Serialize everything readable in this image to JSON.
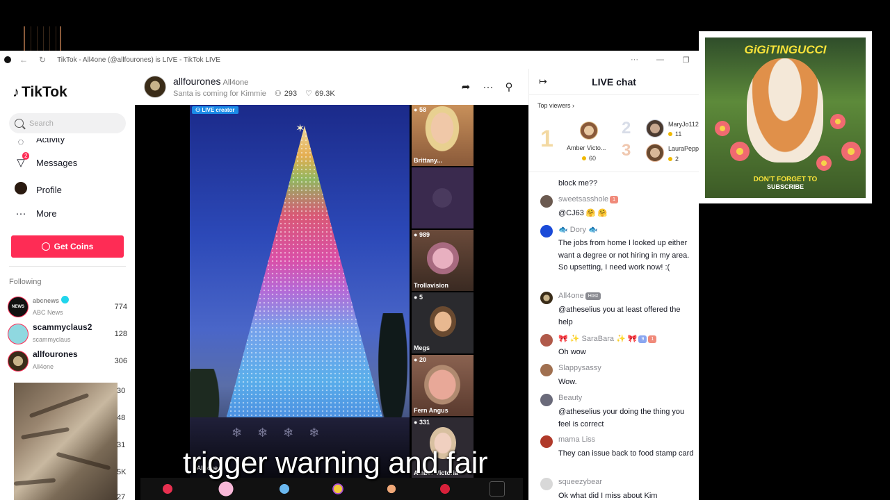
{
  "browser": {
    "title": "TikTok - All4one (@allfourones) is LIVE - TikTok LIVE",
    "controls": [
      "···",
      "—",
      "❐"
    ]
  },
  "sidebar": {
    "brand": "TikTok",
    "search_placeholder": "Search",
    "activity_label": "Activity",
    "nav": [
      {
        "label": "Messages",
        "icon": "paper-plane-icon",
        "badge": "2"
      },
      {
        "label": "Profile",
        "icon": "avatar"
      },
      {
        "label": "More",
        "icon": "more-dots-icon"
      }
    ],
    "get_coins": "Get Coins",
    "following_heading": "Following",
    "following": [
      {
        "name": "abcnews",
        "handle": "ABC News",
        "count": "774",
        "verified": true,
        "color": "#111111"
      },
      {
        "name": "scammyclaus2",
        "handle": "scammyclaus",
        "count": "128",
        "verified": false,
        "color": "#8fd8e0"
      },
      {
        "name": "allfourones",
        "handle": "All4one",
        "count": "306",
        "verified": false,
        "color": "#3a2c18"
      }
    ],
    "partial_counts": [
      "30",
      "48",
      "31",
      "5K",
      "27"
    ]
  },
  "stream": {
    "host_name": "allfourones",
    "host_nick": "All4one",
    "subtitle": "Santa is coming for Kimmie",
    "viewers": "293",
    "likes": "69.3K",
    "live_tag": "LIVE creator",
    "host_overlay": "All4one",
    "guests": [
      {
        "count": "58",
        "name": "Brittany...",
        "bg": "#a8704a"
      },
      {
        "count": "",
        "name": "",
        "bg": "#3a2a4e"
      },
      {
        "count": "989",
        "name": "Trollavision",
        "bg": "#5a3a2a"
      },
      {
        "count": "5",
        "name": "Megs",
        "bg": "#2a2a2e"
      },
      {
        "count": "20",
        "name": "Fern Angus",
        "bg": "#7a5240"
      },
      {
        "count": "331",
        "name": "Amber Victoria",
        "bg": "#2e2a32"
      }
    ]
  },
  "overlay_caption": "trigger warning and fair",
  "chat": {
    "title": "LIVE chat",
    "top_viewers_label": "Top viewers",
    "top_viewers": [
      {
        "rank": "1",
        "name": "Amber Victo...",
        "points": "60"
      },
      {
        "rank": "2",
        "name": "MaryJo112",
        "points": "11"
      },
      {
        "rank": "3",
        "name": "LauraPepp",
        "points": "2"
      }
    ],
    "messages": [
      {
        "user": "",
        "text": "block me??",
        "color": "#ffffff"
      },
      {
        "user": "sweetsasshole",
        "badge": "1",
        "badge_color": "#f08a7a",
        "text": "@CJ63 🤗 🤗",
        "color": "#6b5a50"
      },
      {
        "user": "🐟 Dory 🐟",
        "text": "The jobs from home I looked up either want a degree or not hiring in my area. So upsetting, I need work now! :(",
        "color": "#1a4ad8"
      },
      {
        "user": "All4one",
        "badge": "Host",
        "badge_color": "#8a8b91",
        "text": "@atheselius you at least offered the help",
        "color": "#3a2c18"
      },
      {
        "user": "🎀 ✨ SaraBara ✨ 🎀",
        "badge": "9",
        "badge_color": "#8aa6f0",
        "badge2": "1",
        "badge2_color": "#f08a7a",
        "text": "Oh wow",
        "color": "#b05a4a"
      },
      {
        "user": "Slappysassy",
        "text": "Wow.",
        "color": "#a07050"
      },
      {
        "user": "Beauty",
        "text": "@atheselius your doing the thing you feel is correct",
        "color": "#6a6a7a"
      },
      {
        "user": "mama Liss",
        "text": "They can issue back to food stamp card",
        "color": "#b03a2a"
      },
      {
        "user": "squeezybear",
        "text": "Ok what did I miss about Kim",
        "color": "#c8c8c8"
      }
    ]
  },
  "poster": {
    "title": "GiGiTINGUCCI",
    "cta": "DON'T FORGET TO",
    "cta2": "SUBSCRIBE"
  }
}
